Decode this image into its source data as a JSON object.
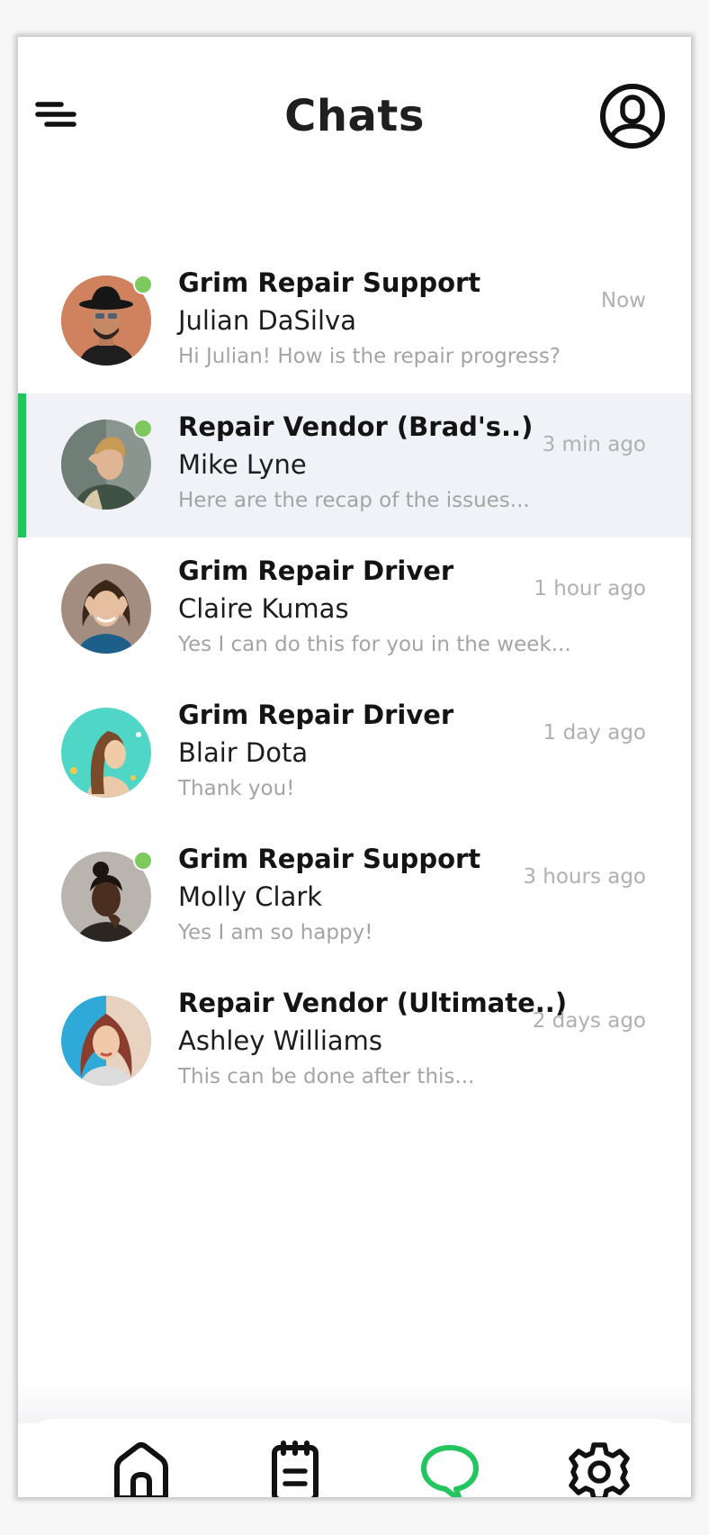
{
  "header": {
    "title": "Chats",
    "menu_icon": "menu-icon",
    "profile_icon": "user-profile-icon"
  },
  "colors": {
    "accent": "#22c55e",
    "online": "#7dc95e",
    "active_row_bg": "#f1f2f8",
    "text_muted": "#a4a4a4"
  },
  "chats": [
    {
      "title": "Grim Repair Support",
      "name": "Julian DaSilva",
      "preview": "Hi Julian! How is the repair progress?",
      "time": "Now",
      "online": true,
      "active": false
    },
    {
      "title": "Repair Vendor (Brad's..)",
      "name": "Mike Lyne",
      "preview": "Here are the recap of the issues...",
      "time": "3 min ago",
      "online": true,
      "active": true
    },
    {
      "title": "Grim Repair Driver",
      "name": "Claire Kumas",
      "preview": "Yes I can do this for you in the week...",
      "time": "1 hour ago",
      "online": false,
      "active": false
    },
    {
      "title": "Grim Repair Driver",
      "name": "Blair Dota",
      "preview": "Thank you!",
      "time": "1 day ago",
      "online": false,
      "active": false
    },
    {
      "title": "Grim Repair Support",
      "name": "Molly Clark",
      "preview": "Yes I am so happy!",
      "time": "3 hours ago",
      "online": true,
      "active": false
    },
    {
      "title": "Repair Vendor (Ultimate..)",
      "name": "Ashley Williams",
      "preview": "This can be done after this...",
      "time": "2 days ago",
      "online": false,
      "active": false
    }
  ],
  "bottom_nav": [
    {
      "icon": "home-icon",
      "active": false
    },
    {
      "icon": "notes-icon",
      "active": false
    },
    {
      "icon": "chat-bubble-icon",
      "active": true
    },
    {
      "icon": "gear-icon",
      "active": false
    }
  ]
}
